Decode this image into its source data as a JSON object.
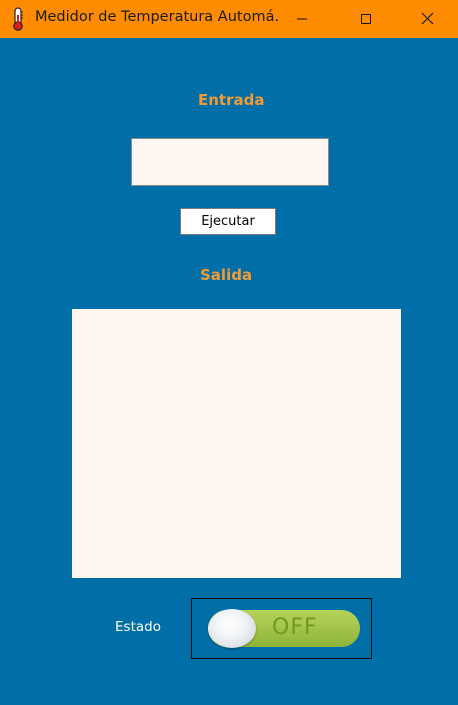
{
  "window": {
    "title": "Medidor de Temperatura Automá...",
    "titlebar_color": "#ff8c00",
    "background_color": "#006ea7",
    "icon": "thermometer-icon"
  },
  "controls": {
    "minimize_icon": "minimize-icon",
    "maximize_icon": "maximize-icon",
    "close_icon": "close-icon"
  },
  "entrada": {
    "label": "Entrada",
    "value": "",
    "placeholder": ""
  },
  "run_button": {
    "label": "Ejecutar"
  },
  "salida": {
    "label": "Salida",
    "text": ""
  },
  "estado": {
    "label": "Estado",
    "toggle_text": "OFF",
    "state": "off"
  },
  "colors": {
    "accent_label": "#f49a32",
    "field_background": "#fff5f1",
    "toggle_green": "#9dc044"
  }
}
